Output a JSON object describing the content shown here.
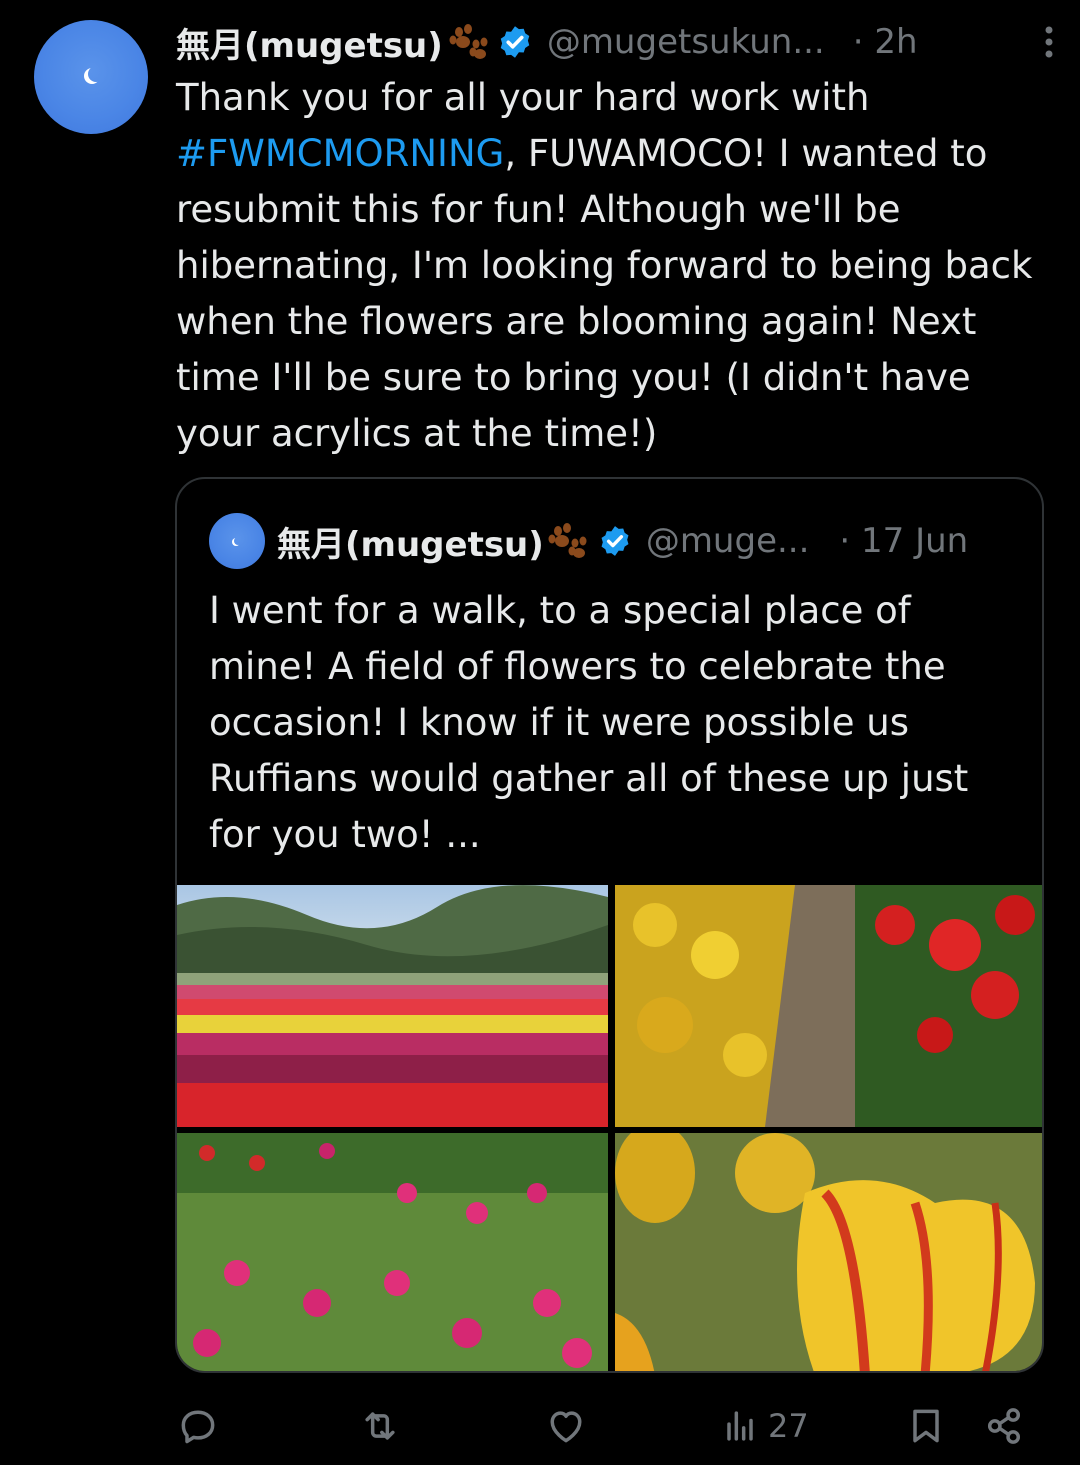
{
  "tweet": {
    "author_name": "無月(mugetsu)",
    "handle": "@mugetsukun...",
    "time": "· 2h",
    "text_before": "Thank you for all your hard work with ",
    "hashtag": "#FWMCMORNING",
    "text_after": ", FUWAMOCO! I wanted to resubmit this for fun! Although we'll be hibernating, I'm looking forward to being back when the flowers are blooming again! Next time I'll be sure to bring you! (I didn't have your acrylics at the time!)"
  },
  "quote": {
    "author_name": "無月(mugetsu)",
    "handle": "@muge...",
    "time": "· 17 Jun",
    "text": "I went for a walk, to a special place of mine! A field of flowers to celebrate the occasion! I know if it were possible us Ruffians would gather all of these up just for you two! ..."
  },
  "actions": {
    "views": "27"
  },
  "colors": {
    "background": "#000000",
    "text": "#e7e9ea",
    "muted": "#71767b",
    "accent": "#1d9bf0",
    "border": "#2f3336"
  },
  "icons": [
    "more-icon",
    "verified-badge-icon",
    "paw-emoji-icon",
    "reply-icon",
    "retweet-icon",
    "like-icon",
    "views-icon",
    "bookmark-icon",
    "share-icon"
  ]
}
